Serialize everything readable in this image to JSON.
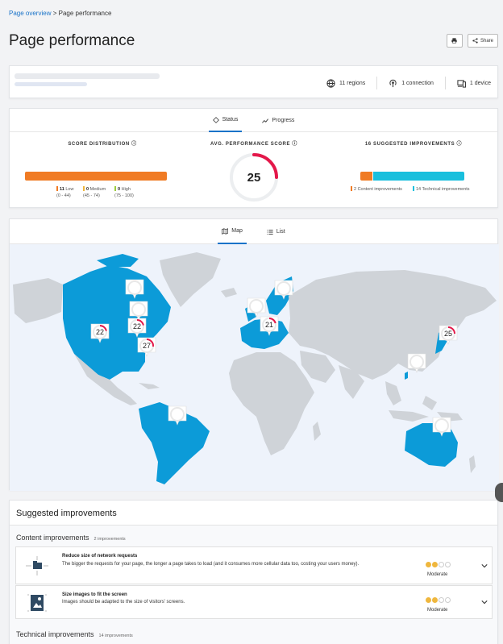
{
  "breadcrumb": {
    "parent": "Page overview",
    "sep": " > ",
    "current": "Page performance"
  },
  "page_title": "Page performance",
  "actions": {
    "print_icon": "printer-icon",
    "share_label": "Share"
  },
  "header": {
    "regions": "11 regions",
    "connections": "1 connection",
    "devices": "1 device"
  },
  "status_tabs": [
    {
      "label": "Status"
    },
    {
      "label": "Progress"
    }
  ],
  "score_distribution": {
    "title": "SCORE DISTRIBUTION",
    "low": {
      "count": "11",
      "label": "Low",
      "range": "(0 - 44)"
    },
    "medium": {
      "count": "0",
      "label": "Medium",
      "range": "(45 - 74)"
    },
    "high": {
      "count": "0",
      "label": "High",
      "range": "(75 - 100)"
    },
    "low_fraction": 1.0
  },
  "avg_score": {
    "title": "AVG. PERFORMANCE SCORE",
    "value": "25",
    "fraction": 0.25
  },
  "suggested": {
    "title": "16 SUGGESTED IMPROVEMENTS",
    "content": "2 Content improvements",
    "technical": "14 Technical improvements"
  },
  "map_tabs": [
    {
      "label": "Map"
    },
    {
      "label": "List"
    }
  ],
  "map_markers": [
    {
      "label": "22",
      "score": 22
    },
    {
      "label": "22",
      "score": 22
    },
    {
      "label": "27",
      "score": 27
    },
    {
      "label": "21",
      "score": 21
    },
    {
      "label": "25",
      "score": 25
    }
  ],
  "improvements": {
    "title": "Suggested improvements",
    "content_section": {
      "title": "Content improvements",
      "count": "2 improvements"
    },
    "items": [
      {
        "title": "Reduce size of network requests",
        "desc": "The bigger the requests for your page, the longer a page takes to load (and it consumes more cellular data too, costing your users money).",
        "level": "Moderate",
        "rating": 2
      },
      {
        "title": "Size images to fit the screen",
        "desc": "Images should be adapted to the size of visitors' screens.",
        "level": "Moderate",
        "rating": 2
      }
    ],
    "technical_section": {
      "title": "Technical improvements",
      "count": "14 improvements"
    }
  },
  "colors": {
    "accent": "#1a73c8",
    "low": "#f07b24",
    "medium": "#efb73e",
    "high": "#9ccc3d",
    "technical": "#19bfdd",
    "map_land": "#cfd3d8",
    "map_active": "#0c9bd8",
    "score_red": "#e4184a"
  }
}
